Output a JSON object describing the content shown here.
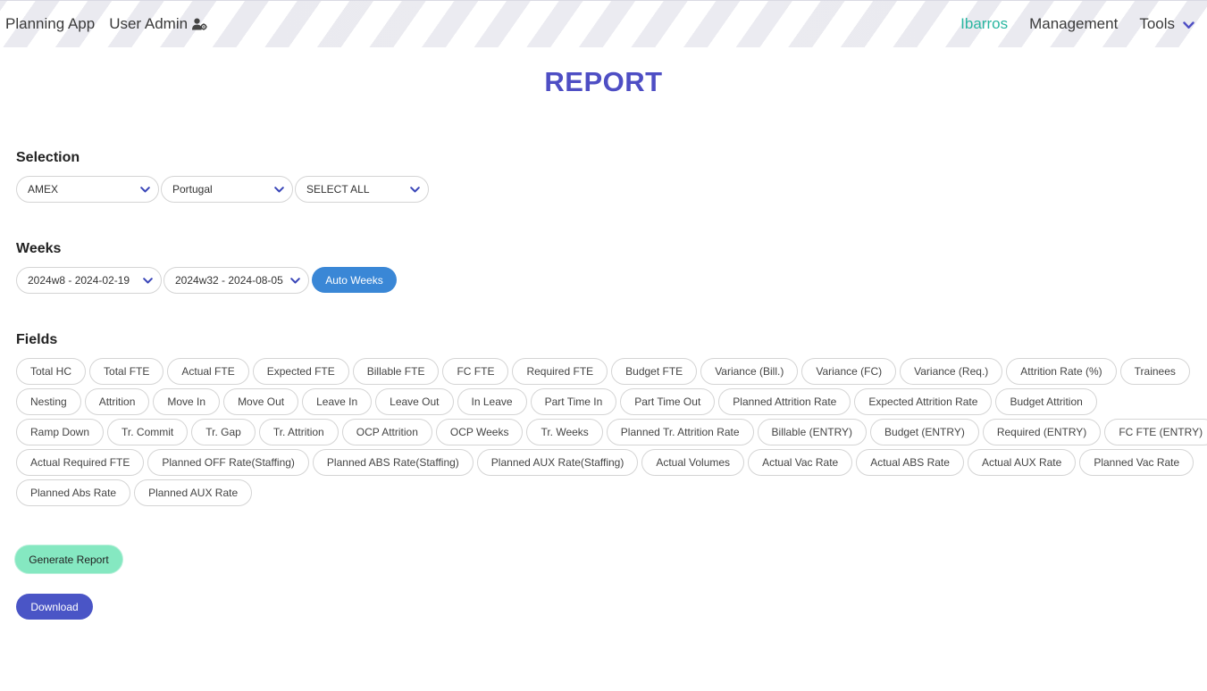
{
  "nav": {
    "brand": "Planning App",
    "user_admin": "User Admin",
    "user_admin_icon": "user-gear-icon",
    "links": [
      "Ibarros",
      "Management",
      "Tools"
    ],
    "tools_icon": "chevron-down-icon",
    "user_color": "#29b6a0",
    "accent": "#4e4ec4"
  },
  "page_title": "REPORT",
  "selection": {
    "heading": "Selection",
    "client": "AMEX",
    "country": "Portugal",
    "scope": "SELECT ALL"
  },
  "weeks": {
    "heading": "Weeks",
    "start": "2024w8 - 2024-02-19",
    "end": "2024w32 - 2024-08-05",
    "auto_label": "Auto Weeks"
  },
  "fields": {
    "heading": "Fields",
    "rows": [
      [
        "Total HC",
        "Total FTE",
        "Actual FTE",
        "Expected FTE",
        "Billable FTE",
        "FC FTE",
        "Required FTE",
        "Budget FTE",
        "Variance (Bill.)",
        "Variance (FC)",
        "Variance (Req.)",
        "Attrition Rate (%)",
        "Trainees"
      ],
      [
        "Nesting",
        "Attrition",
        "Move In",
        "Move Out",
        "Leave In",
        "Leave Out",
        "In Leave",
        "Part Time In",
        "Part Time Out",
        "Planned Attrition Rate",
        "Expected Attrition Rate",
        "Budget Attrition"
      ],
      [
        "Ramp Down",
        "Tr. Commit",
        "Tr. Gap",
        "Tr. Attrition",
        "OCP Attrition",
        "OCP Weeks",
        "Tr. Weeks",
        "Planned Tr. Attrition Rate",
        "Billable (ENTRY)",
        "Budget (ENTRY)",
        "Required (ENTRY)",
        "FC FTE (ENTRY)"
      ],
      [
        "Actual Required FTE",
        "Planned OFF Rate(Staffing)",
        "Planned ABS Rate(Staffing)",
        "Planned AUX Rate(Staffing)",
        "Actual Volumes",
        "Actual Vac Rate",
        "Actual ABS Rate",
        "Actual AUX Rate",
        "Planned Vac Rate"
      ],
      [
        "Planned Abs Rate",
        "Planned AUX Rate"
      ]
    ]
  },
  "actions": {
    "generate": "Generate Report",
    "download": "Download",
    "generate_color": "#85e8c1",
    "download_color": "#4a55c6"
  }
}
